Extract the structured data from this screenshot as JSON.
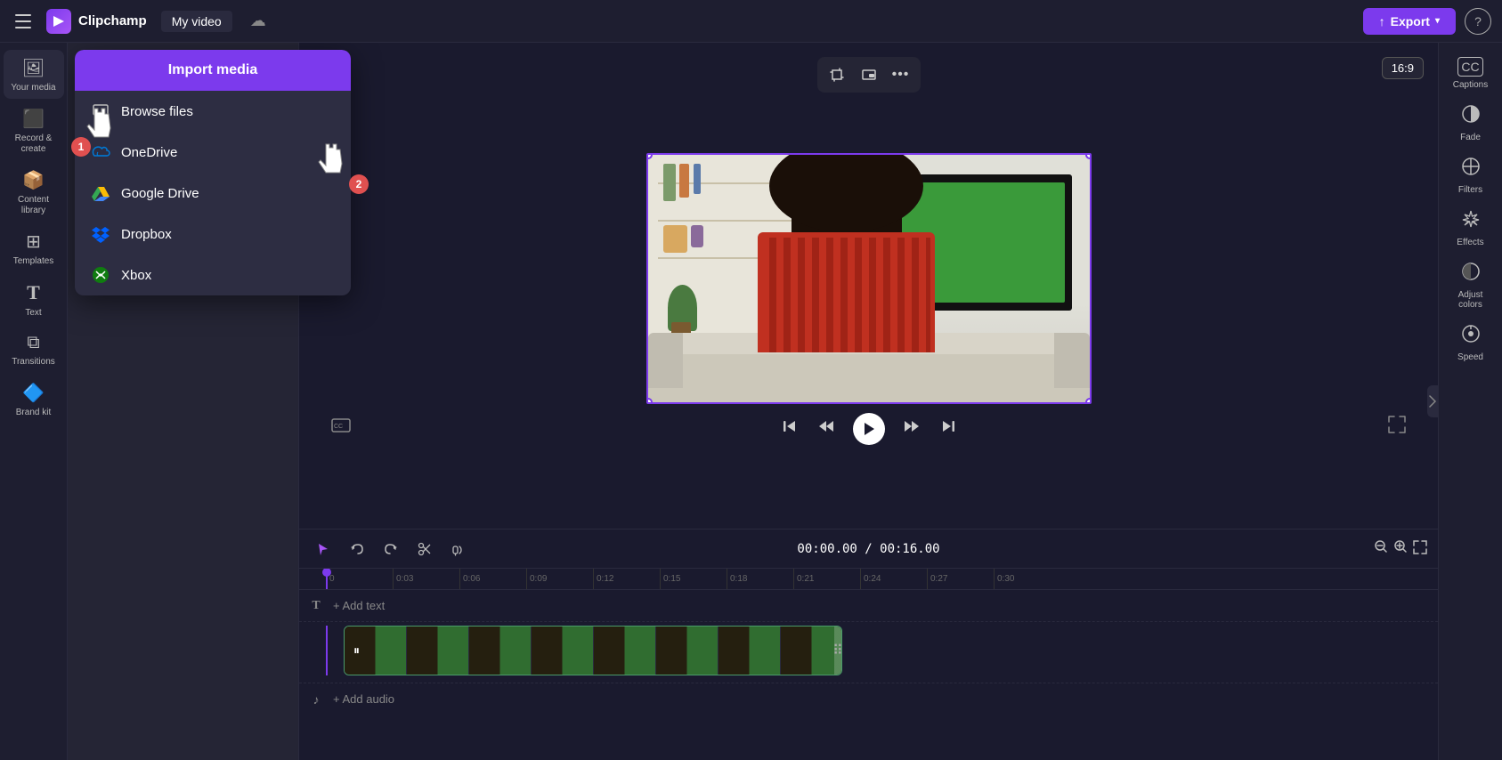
{
  "app": {
    "title": "Clipchamp",
    "project_name": "My video",
    "logo_emoji": "🎬"
  },
  "topbar": {
    "menu_label": "Menu",
    "logo_text": "Clipchamp",
    "project_name": "My video",
    "export_label": "Export",
    "help_label": "?"
  },
  "left_sidebar": {
    "items": [
      {
        "id": "your-media",
        "label": "Your media",
        "icon": "🖼"
      },
      {
        "id": "record-create",
        "label": "Record & create",
        "icon": "⬛"
      },
      {
        "id": "content-library",
        "label": "Content library",
        "icon": "📦"
      },
      {
        "id": "templates",
        "label": "Templates",
        "icon": "⊞"
      },
      {
        "id": "text",
        "label": "Text",
        "icon": "T"
      },
      {
        "id": "transitions",
        "label": "Transitions",
        "icon": "⧉"
      },
      {
        "id": "brand-kit",
        "label": "Brand kit",
        "icon": "🔷"
      }
    ]
  },
  "import_dropdown": {
    "import_btn_label": "Import media",
    "menu_items": [
      {
        "id": "browse-files",
        "label": "Browse files",
        "icon": "computer"
      },
      {
        "id": "onedrive",
        "label": "OneDrive",
        "icon": "onedrive"
      },
      {
        "id": "google-drive",
        "label": "Google Drive",
        "icon": "gdrive"
      },
      {
        "id": "dropbox",
        "label": "Dropbox",
        "icon": "dropbox"
      },
      {
        "id": "xbox",
        "label": "Xbox",
        "icon": "xbox"
      }
    ]
  },
  "cursor_badges": [
    {
      "id": "cursor1",
      "number": "1",
      "color": "#e05050"
    },
    {
      "id": "cursor2",
      "number": "2",
      "color": "#e05050"
    }
  ],
  "preview": {
    "aspect_ratio": "16:9",
    "toolbar_buttons": [
      "crop",
      "picture-in-picture",
      "more"
    ]
  },
  "playback": {
    "timecode_current": "00:00.00",
    "timecode_total": "00:16.00",
    "timecode_display": "00:00.00 / 00:16.00"
  },
  "timeline": {
    "ruler_marks": [
      "0",
      "0:03",
      "0:06",
      "0:09",
      "0:12",
      "0:15",
      "0:18",
      "0:21",
      "0:24",
      "0:27",
      "0:30"
    ],
    "add_text_label": "+ Add text",
    "add_audio_label": "+ Add audio",
    "video_track_duration": "16s"
  },
  "right_sidebar": {
    "items": [
      {
        "id": "captions",
        "label": "Captions",
        "icon": "CC"
      },
      {
        "id": "fade",
        "label": "Fade",
        "icon": "◑"
      },
      {
        "id": "filters",
        "label": "Filters",
        "icon": "⊘"
      },
      {
        "id": "effects",
        "label": "Effects",
        "icon": "✦"
      },
      {
        "id": "adjust-colors",
        "label": "Adjust colors",
        "icon": "◑"
      },
      {
        "id": "speed",
        "label": "Speed",
        "icon": "⊙"
      }
    ]
  }
}
